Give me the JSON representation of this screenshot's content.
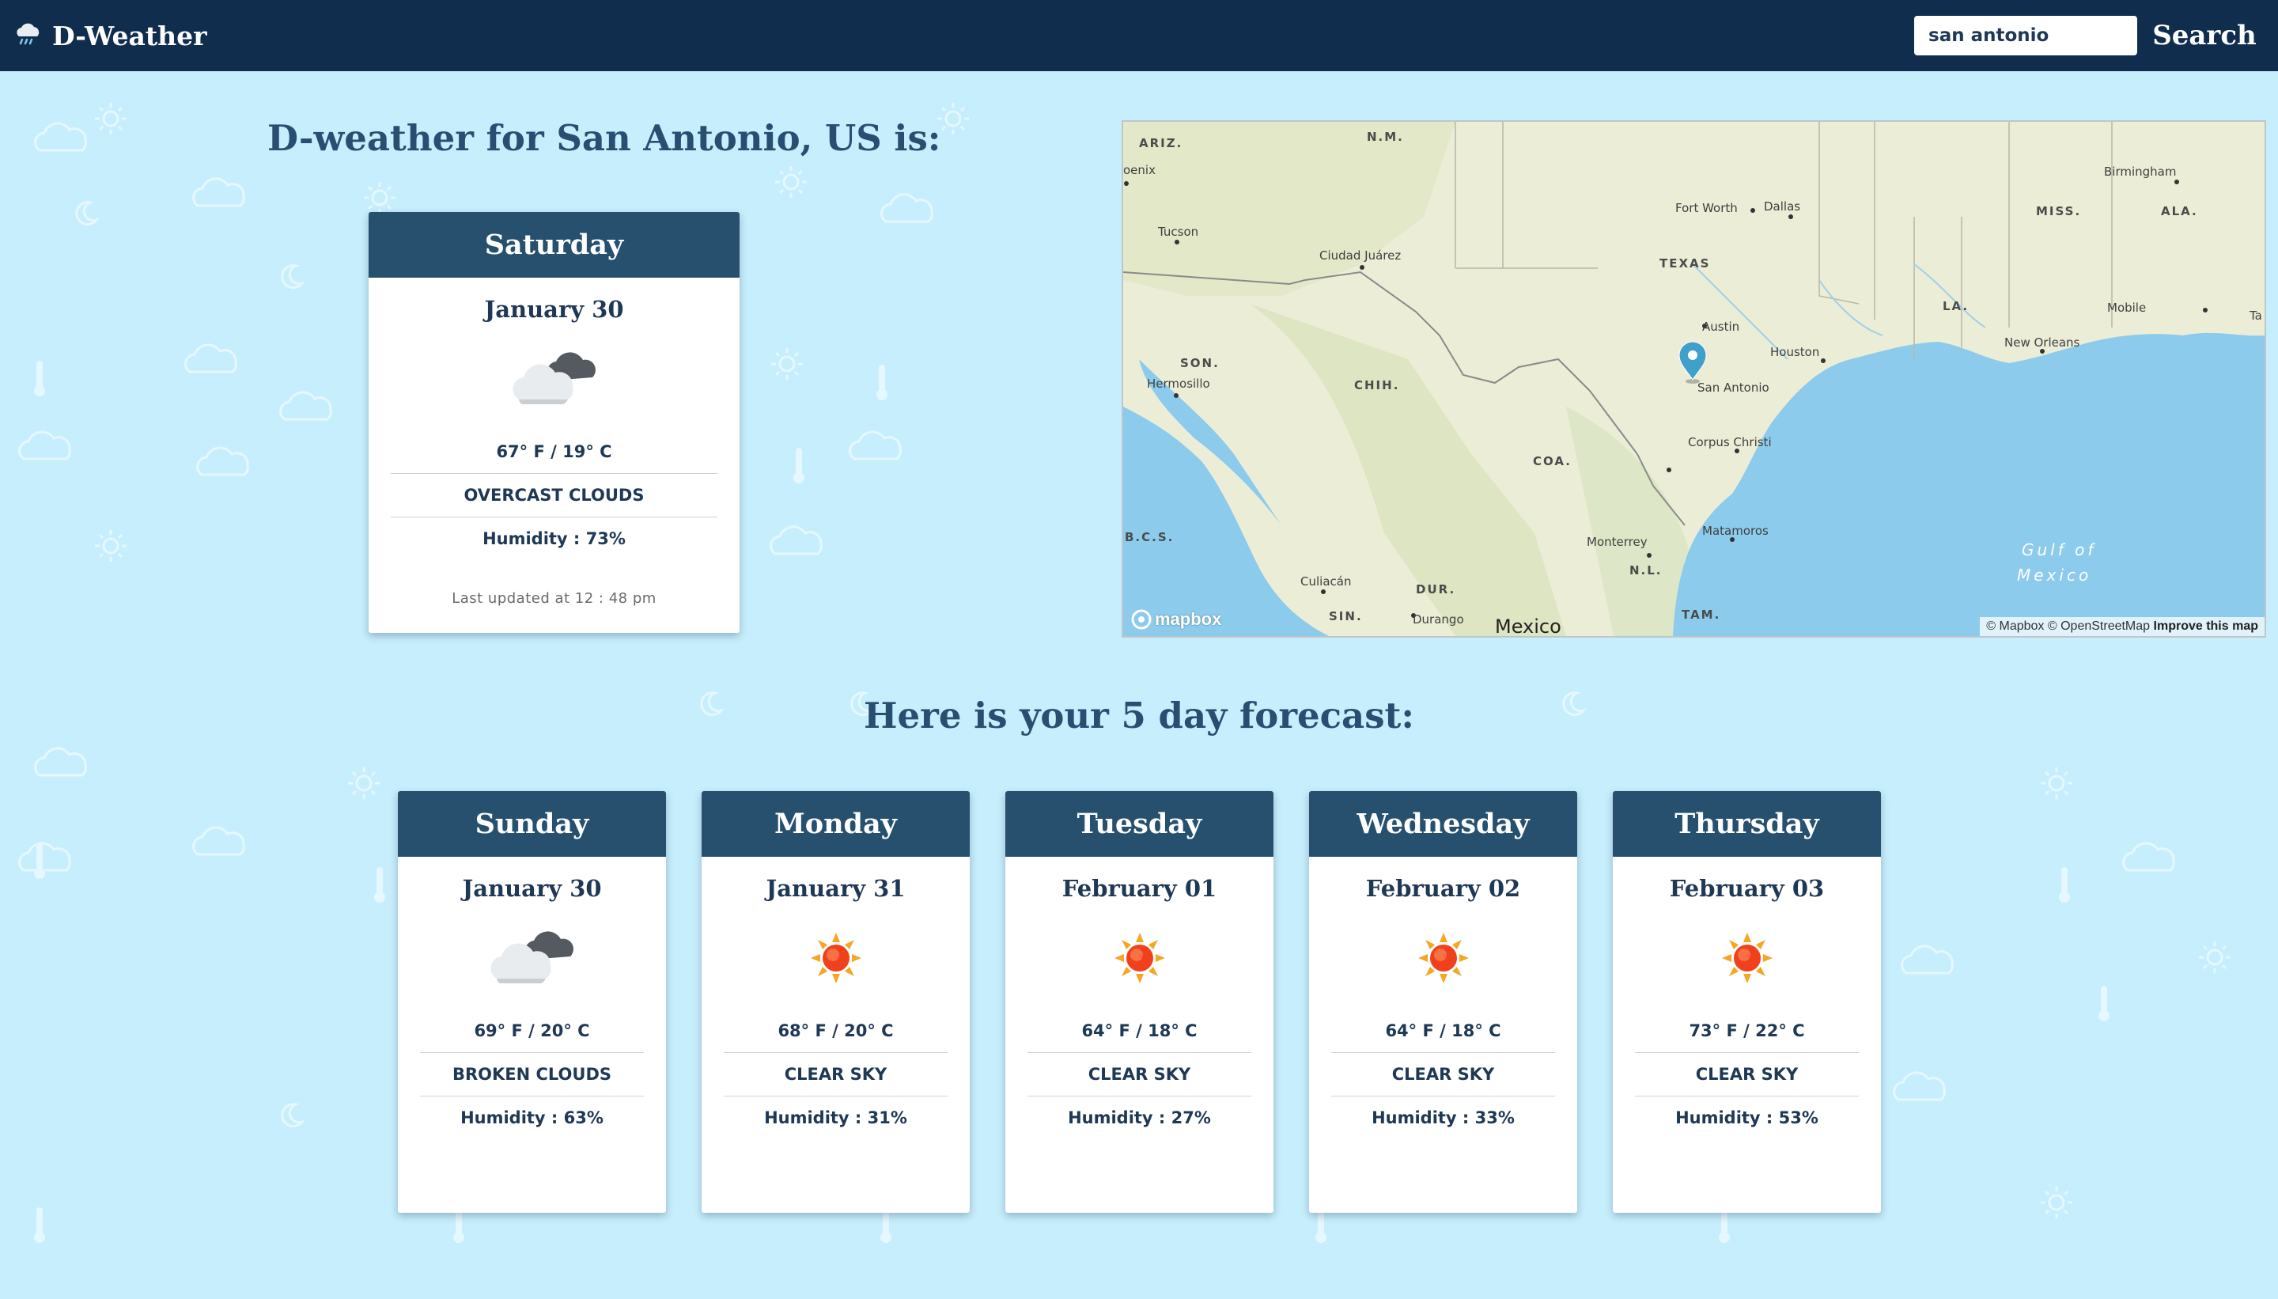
{
  "brand": {
    "name": "D-Weather",
    "icon": "rain-cloud-icon"
  },
  "search": {
    "value": "san antonio",
    "button_label": "Search"
  },
  "current": {
    "heading": "D-weather for San Antonio, US is:",
    "day": "Saturday",
    "date": "January 30",
    "icon": "overcast-clouds-icon",
    "temp": "67° F / 19° C",
    "description": "OVERCAST CLOUDS",
    "humidity": "Humidity : 73%",
    "updated": "Last updated at 12 : 48 pm"
  },
  "map": {
    "marker_label": "San Antonio",
    "credit": "© Mapbox © OpenStreetMap",
    "improve_label": "Improve this map",
    "logo": "mapbox",
    "labels": {
      "ariz": "ARIZ.",
      "nm": "N.M.",
      "phoenix": "oenix",
      "tucson": "Tucson",
      "ciudad_juarez": "Ciudad Juárez",
      "fort_worth": "Fort Worth",
      "dallas": "Dallas",
      "texas": "TEXAS",
      "austin": "Austin",
      "houston": "Houston",
      "birmingham": "Birmingham",
      "miss": "MISS.",
      "ala": "ALA.",
      "la": "LA.",
      "mobile": "Mobile",
      "ta": "Ta",
      "new_orleans": "New Orleans",
      "son": "SON.",
      "hermosillo": "Hermosillo",
      "chih": "CHIH.",
      "corpus_christi": "Corpus Christi",
      "coa": "COA.",
      "bcs": "B.C.S.",
      "monterrey": "Monterrey",
      "matamoros": "Matamoros",
      "nl": "N.L.",
      "culiacan": "Culiacán",
      "dur": "DUR.",
      "sin": "SIN.",
      "durango": "Durango",
      "mexico": "Mexico",
      "tam": "TAM.",
      "gulf1": "Gulf of",
      "gulf2": "Mexico"
    }
  },
  "forecast": {
    "heading": "Here is your 5 day forecast:",
    "days": [
      {
        "day": "Sunday",
        "date": "January 30",
        "icon": "broken-clouds-icon",
        "temp": "69° F / 20° C",
        "description": "BROKEN CLOUDS",
        "humidity": "Humidity : 63%"
      },
      {
        "day": "Monday",
        "date": "January 31",
        "icon": "sun-icon",
        "temp": "68° F / 20° C",
        "description": "CLEAR SKY",
        "humidity": "Humidity : 31%"
      },
      {
        "day": "Tuesday",
        "date": "February 01",
        "icon": "sun-icon",
        "temp": "64° F / 18° C",
        "description": "CLEAR SKY",
        "humidity": "Humidity : 27%"
      },
      {
        "day": "Wednesday",
        "date": "February 02",
        "icon": "sun-icon",
        "temp": "64° F / 18° C",
        "description": "CLEAR SKY",
        "humidity": "Humidity : 33%"
      },
      {
        "day": "Thursday",
        "date": "February 03",
        "icon": "sun-icon",
        "temp": "73° F / 22° C",
        "description": "CLEAR SKY",
        "humidity": "Humidity : 53%"
      }
    ]
  },
  "colors": {
    "navbar": "#112d4e",
    "background": "#c7eefc",
    "card_header": "#27506f",
    "heading": "#284f72"
  }
}
